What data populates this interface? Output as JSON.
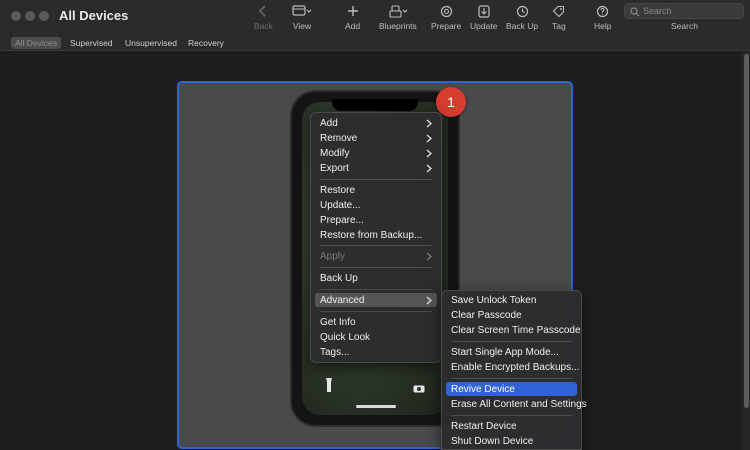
{
  "window": {
    "title": "All Devices"
  },
  "toolbar": {
    "back": "Back",
    "view": "View",
    "add": "Add",
    "blueprints": "Blueprints",
    "prepare": "Prepare",
    "update": "Update",
    "back_up": "Back Up",
    "tag": "Tag",
    "help": "Help",
    "search_placeholder": "Search",
    "search_label": "Search"
  },
  "filters": {
    "all": "All Devices",
    "supervised": "Supervised",
    "unsupervised": "Unsupervised",
    "recovery": "Recovery"
  },
  "badge": {
    "count": "1"
  },
  "context_menu": {
    "add": "Add",
    "remove": "Remove",
    "modify": "Modify",
    "export": "Export",
    "restore": "Restore",
    "update": "Update...",
    "prepare": "Prepare...",
    "restore_backup": "Restore from Backup...",
    "apply": "Apply",
    "back_up": "Back Up",
    "advanced": "Advanced",
    "get_info": "Get Info",
    "quick_look": "Quick Look",
    "tags": "Tags..."
  },
  "advanced_menu": {
    "save_unlock_token": "Save Unlock Token",
    "clear_passcode": "Clear Passcode",
    "clear_screen_time": "Clear Screen Time Passcode",
    "single_app_mode": "Start Single App Mode...",
    "encrypted_backups": "Enable Encrypted Backups...",
    "revive": "Revive Device",
    "erase": "Erase All Content and Settings",
    "restart": "Restart Device",
    "shut_down": "Shut Down Device"
  },
  "colors": {
    "selection": "#2f63d6",
    "badge": "#d63c30",
    "tile_border": "#2f63d6"
  }
}
